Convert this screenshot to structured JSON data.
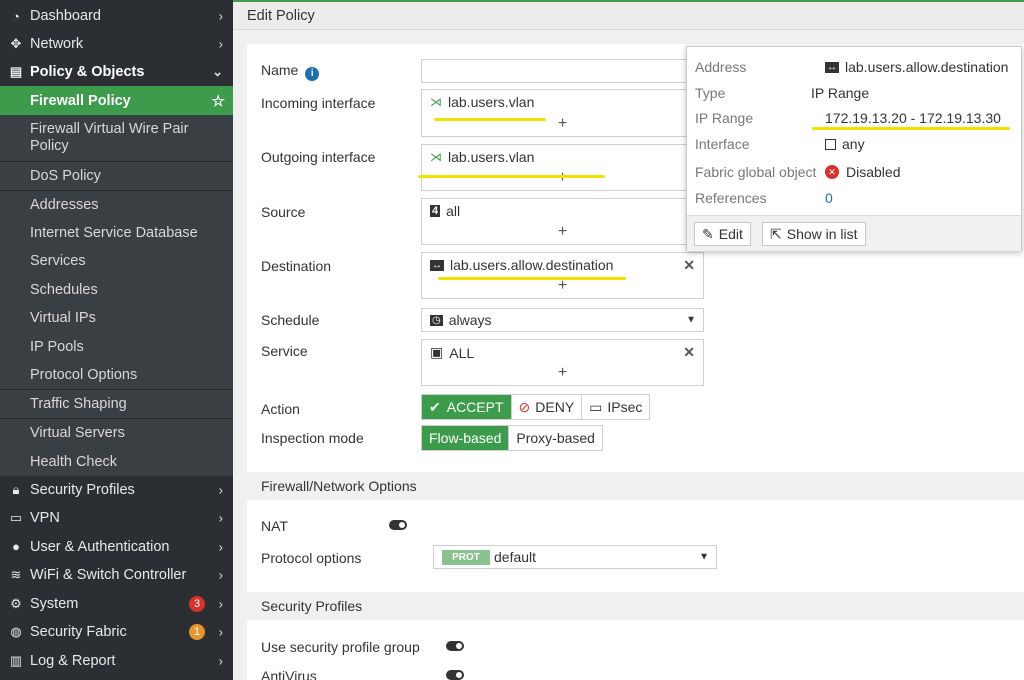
{
  "sidebar": {
    "dashboard": "Dashboard",
    "network": "Network",
    "policy_objects": "Policy & Objects",
    "firewall_policy": "Firewall Policy",
    "fw_vwire": "Firewall Virtual Wire Pair",
    "fw_vwire2": "Policy",
    "dos_policy": "DoS Policy",
    "addresses": "Addresses",
    "isdb": "Internet Service Database",
    "services": "Services",
    "schedules": "Schedules",
    "vips": "Virtual IPs",
    "ip_pools": "IP Pools",
    "protocol_options": "Protocol Options",
    "traffic_shaping": "Traffic Shaping",
    "virtual_servers": "Virtual Servers",
    "health_check": "Health Check",
    "security_profiles": "Security Profiles",
    "vpn": "VPN",
    "user_auth": "User & Authentication",
    "wifi": "WiFi & Switch Controller",
    "system": "System",
    "system_badge": "3",
    "security_fabric": "Security Fabric",
    "fabric_badge": "1",
    "log_report": "Log & Report"
  },
  "header": {
    "title": "Edit Policy"
  },
  "form": {
    "name_label": "Name",
    "name_value": "",
    "incoming_label": "Incoming interface",
    "incoming_value": "lab.users.vlan",
    "outgoing_label": "Outgoing interface",
    "outgoing_value": "lab.users.vlan",
    "source_label": "Source",
    "source_value": "all",
    "destination_label": "Destination",
    "destination_value": "lab.users.allow.destination",
    "schedule_label": "Schedule",
    "schedule_value": "always",
    "service_label": "Service",
    "service_value": "ALL",
    "action_label": "Action",
    "action_accept": "ACCEPT",
    "action_deny": "DENY",
    "action_ipsec": "IPsec",
    "inspection_label": "Inspection mode",
    "flow_based": "Flow-based",
    "proxy_based": "Proxy-based",
    "plus": "+",
    "remove": "✕"
  },
  "firewall_options": {
    "heading": "Firewall/Network Options",
    "nat_label": "NAT",
    "protocol_options_label": "Protocol options",
    "prot_badge": "PROT",
    "protocol_options_value": "default"
  },
  "security_profiles_section": {
    "heading": "Security Profiles",
    "use_group_label": "Use security profile group",
    "antivirus_label": "AntiVirus"
  },
  "popup": {
    "address_key": "Address",
    "address_value": "lab.users.allow.destination",
    "type_key": "Type",
    "type_value": "IP Range",
    "range_key": "IP Range",
    "range_value": "172.19.13.20 - 172.19.13.30",
    "interface_key": "Interface",
    "interface_value": "any",
    "fabric_key": "Fabric global object",
    "fabric_value": "Disabled",
    "references_key": "References",
    "references_value": "0",
    "edit_label": "Edit",
    "show_label": "Show in list"
  },
  "colors": {
    "accent": "#3d9b4c",
    "sidebar": "#2b2f33",
    "highlight": "#f2e200",
    "link": "#1b6fb5"
  }
}
